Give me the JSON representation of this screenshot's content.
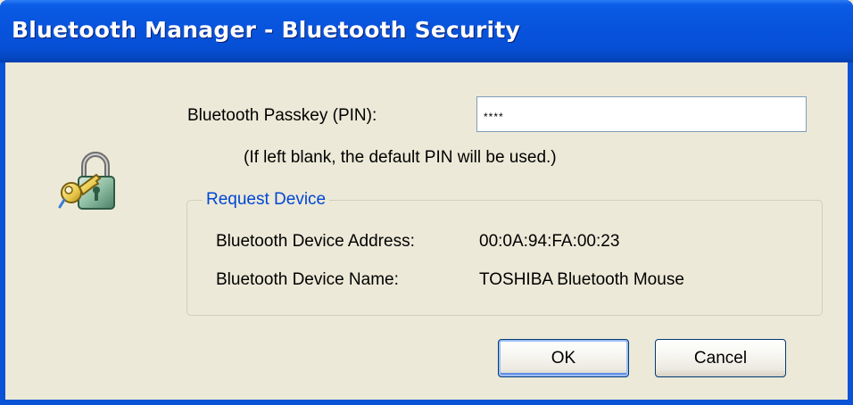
{
  "window": {
    "title": "Bluetooth Manager - Bluetooth Security"
  },
  "icons": {
    "security": "lock-with-key-icon"
  },
  "passkey": {
    "label": "Bluetooth Passkey (PIN):",
    "value": "****",
    "hint": "(If left blank, the default PIN will be used.)"
  },
  "request_device": {
    "legend": "Request Device",
    "address_label": "Bluetooth Device Address:",
    "address_value": "00:0A:94:FA:00:23",
    "name_label": "Bluetooth Device Name:",
    "name_value": "TOSHIBA Bluetooth Mouse"
  },
  "buttons": {
    "ok": "OK",
    "cancel": "Cancel"
  },
  "colors": {
    "titlebar": "#0854dd",
    "window_bg": "#ece9d8",
    "legend_text": "#0046d5"
  }
}
